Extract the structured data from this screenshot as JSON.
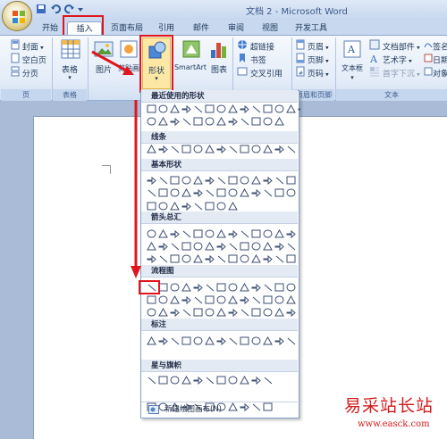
{
  "title_bar": {
    "title": "文档 2 - Microsoft Word"
  },
  "tabs": [
    "开始",
    "插入",
    "页面布局",
    "引用",
    "邮件",
    "审阅",
    "视图",
    "开发工具"
  ],
  "ribbon": {
    "pages_group": {
      "label": "页",
      "items": [
        "封面",
        "空白页",
        "分页"
      ]
    },
    "table_group": {
      "label": "表格",
      "button": "表格"
    },
    "illustrations_group": {
      "buttons": [
        "图片",
        "剪贴画",
        "形状",
        "SmartArt",
        "图表"
      ]
    },
    "links_group": {
      "items": [
        "超链接",
        "书签",
        "交叉引用"
      ]
    },
    "header_footer_group": {
      "label": "页眉和页脚",
      "items": [
        "页眉",
        "页脚",
        "页码"
      ]
    },
    "text_group": {
      "label": "文本",
      "text_box": "文本框",
      "items": [
        "文档部件",
        "艺术字",
        "首字下沉"
      ],
      "right_items": [
        "签名",
        "日期",
        "对象"
      ]
    }
  },
  "shapes_menu": {
    "sections": [
      "最近使用的形状",
      "线条",
      "基本形状",
      "箭头总汇",
      "流程图",
      "标注",
      "星与旗帜"
    ],
    "footer": "新建绘图画布(N)"
  },
  "watermark": {
    "title": "易采站长站",
    "url": "www.easck.com"
  },
  "colors": {
    "highlight": "#e0161f",
    "ribbon": "#dbe7f6",
    "watermark": "#d11b1b"
  }
}
